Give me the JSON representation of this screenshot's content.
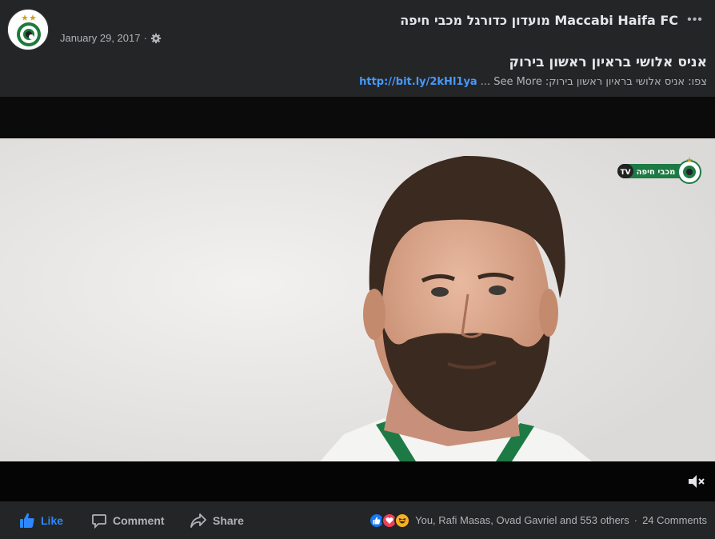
{
  "header": {
    "page_name": "מועדון כדורגל מכבי חיפה Maccabi Haifa FC",
    "date": "January 29, 2017",
    "separator": "·",
    "more_label": "•••",
    "privacy_icon": "gear-icon",
    "avatar_icon": "maccabi-haifa-logo"
  },
  "post": {
    "title": "אניס אלושי בראיון ראשון בירוק",
    "description": "צפו: אניס אלושי בראיון ראשון בירוק:",
    "link": "http://bit.ly/2kHl1ya",
    "see_more": "... See More"
  },
  "video": {
    "badge_text": "מכבי חיפה",
    "badge_tv": "TV",
    "mute_icon": "volume-muted-icon"
  },
  "footer": {
    "like_label": "Like",
    "comment_label": "Comment",
    "share_label": "Share",
    "reactions_text": "You, Rafi Masas, Ovad Gavriel and 553 others",
    "dot": "·",
    "comments_count": "24 Comments",
    "colors": {
      "accent": "#2d88ff",
      "like": "#1877f2",
      "love": "#f33e58",
      "haha": "#f7b125"
    }
  }
}
